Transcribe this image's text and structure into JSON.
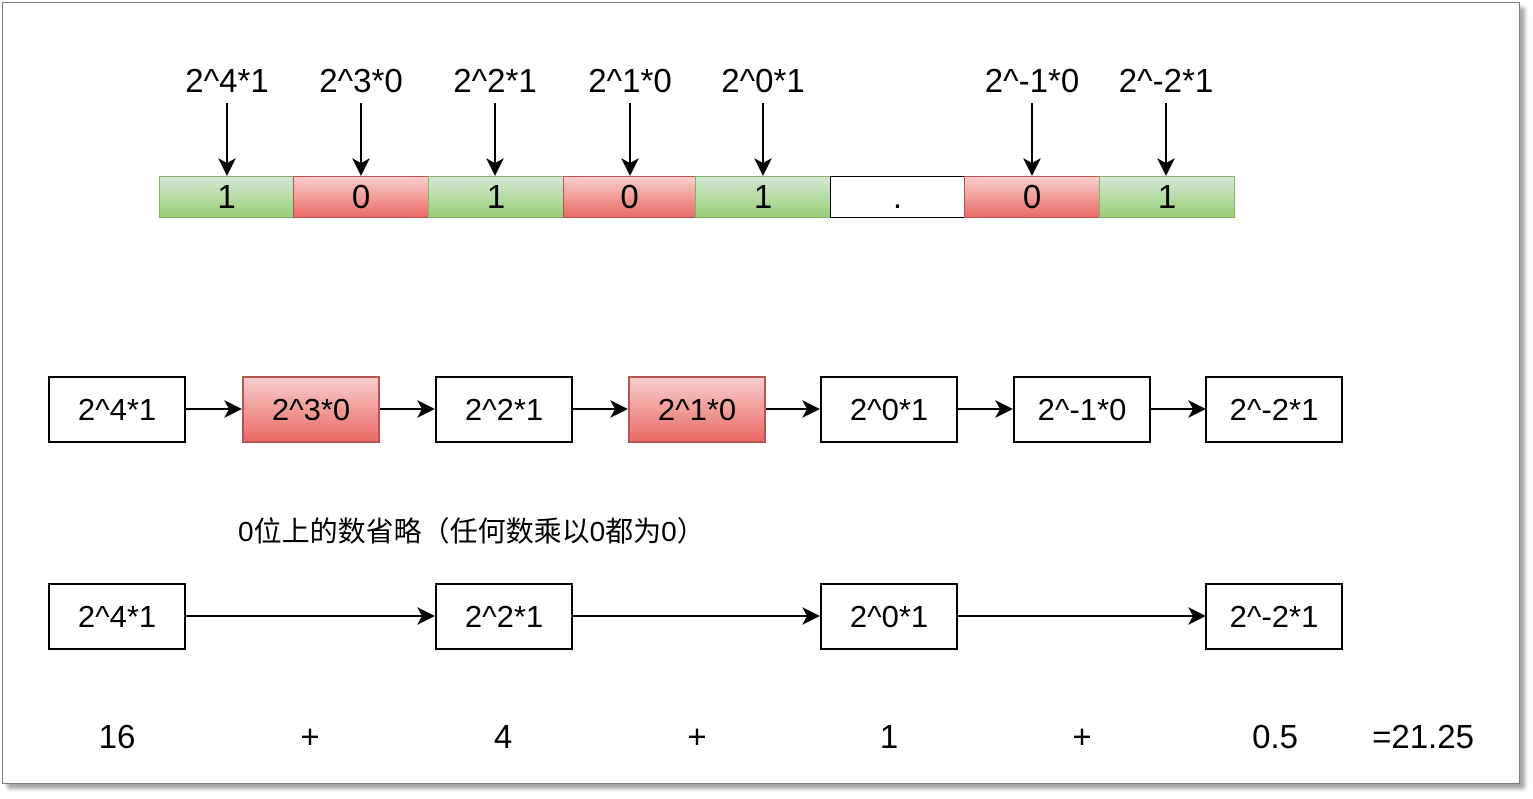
{
  "bit_labels": [
    "2^4*1",
    "2^3*0",
    "2^2*1",
    "2^1*0",
    "2^0*1",
    "2^-1*0",
    "2^-2*1"
  ],
  "bits": [
    "1",
    "0",
    "1",
    "0",
    "1",
    ".",
    "0",
    "1"
  ],
  "term_chain": [
    "2^4*1",
    "2^3*0",
    "2^2*1",
    "2^1*0",
    "2^0*1",
    "2^-1*0",
    "2^-2*1"
  ],
  "note": "0位上的数省略（任何数乘以0都为0）",
  "nonzero_terms": [
    "2^4*1",
    "2^2*1",
    "2^0*1",
    "2^-2*1"
  ],
  "sum_row": {
    "values": [
      "16",
      "4",
      "1",
      "0.5"
    ],
    "plus": "+",
    "result": "=21.25"
  },
  "colors": {
    "one_fill_top": "#d5e8d4",
    "one_fill_bottom": "#97d077",
    "one_border": "#82b366",
    "zero_fill_top": "#f8cecc",
    "zero_fill_bottom": "#ea6b66",
    "zero_border": "#b85450"
  }
}
